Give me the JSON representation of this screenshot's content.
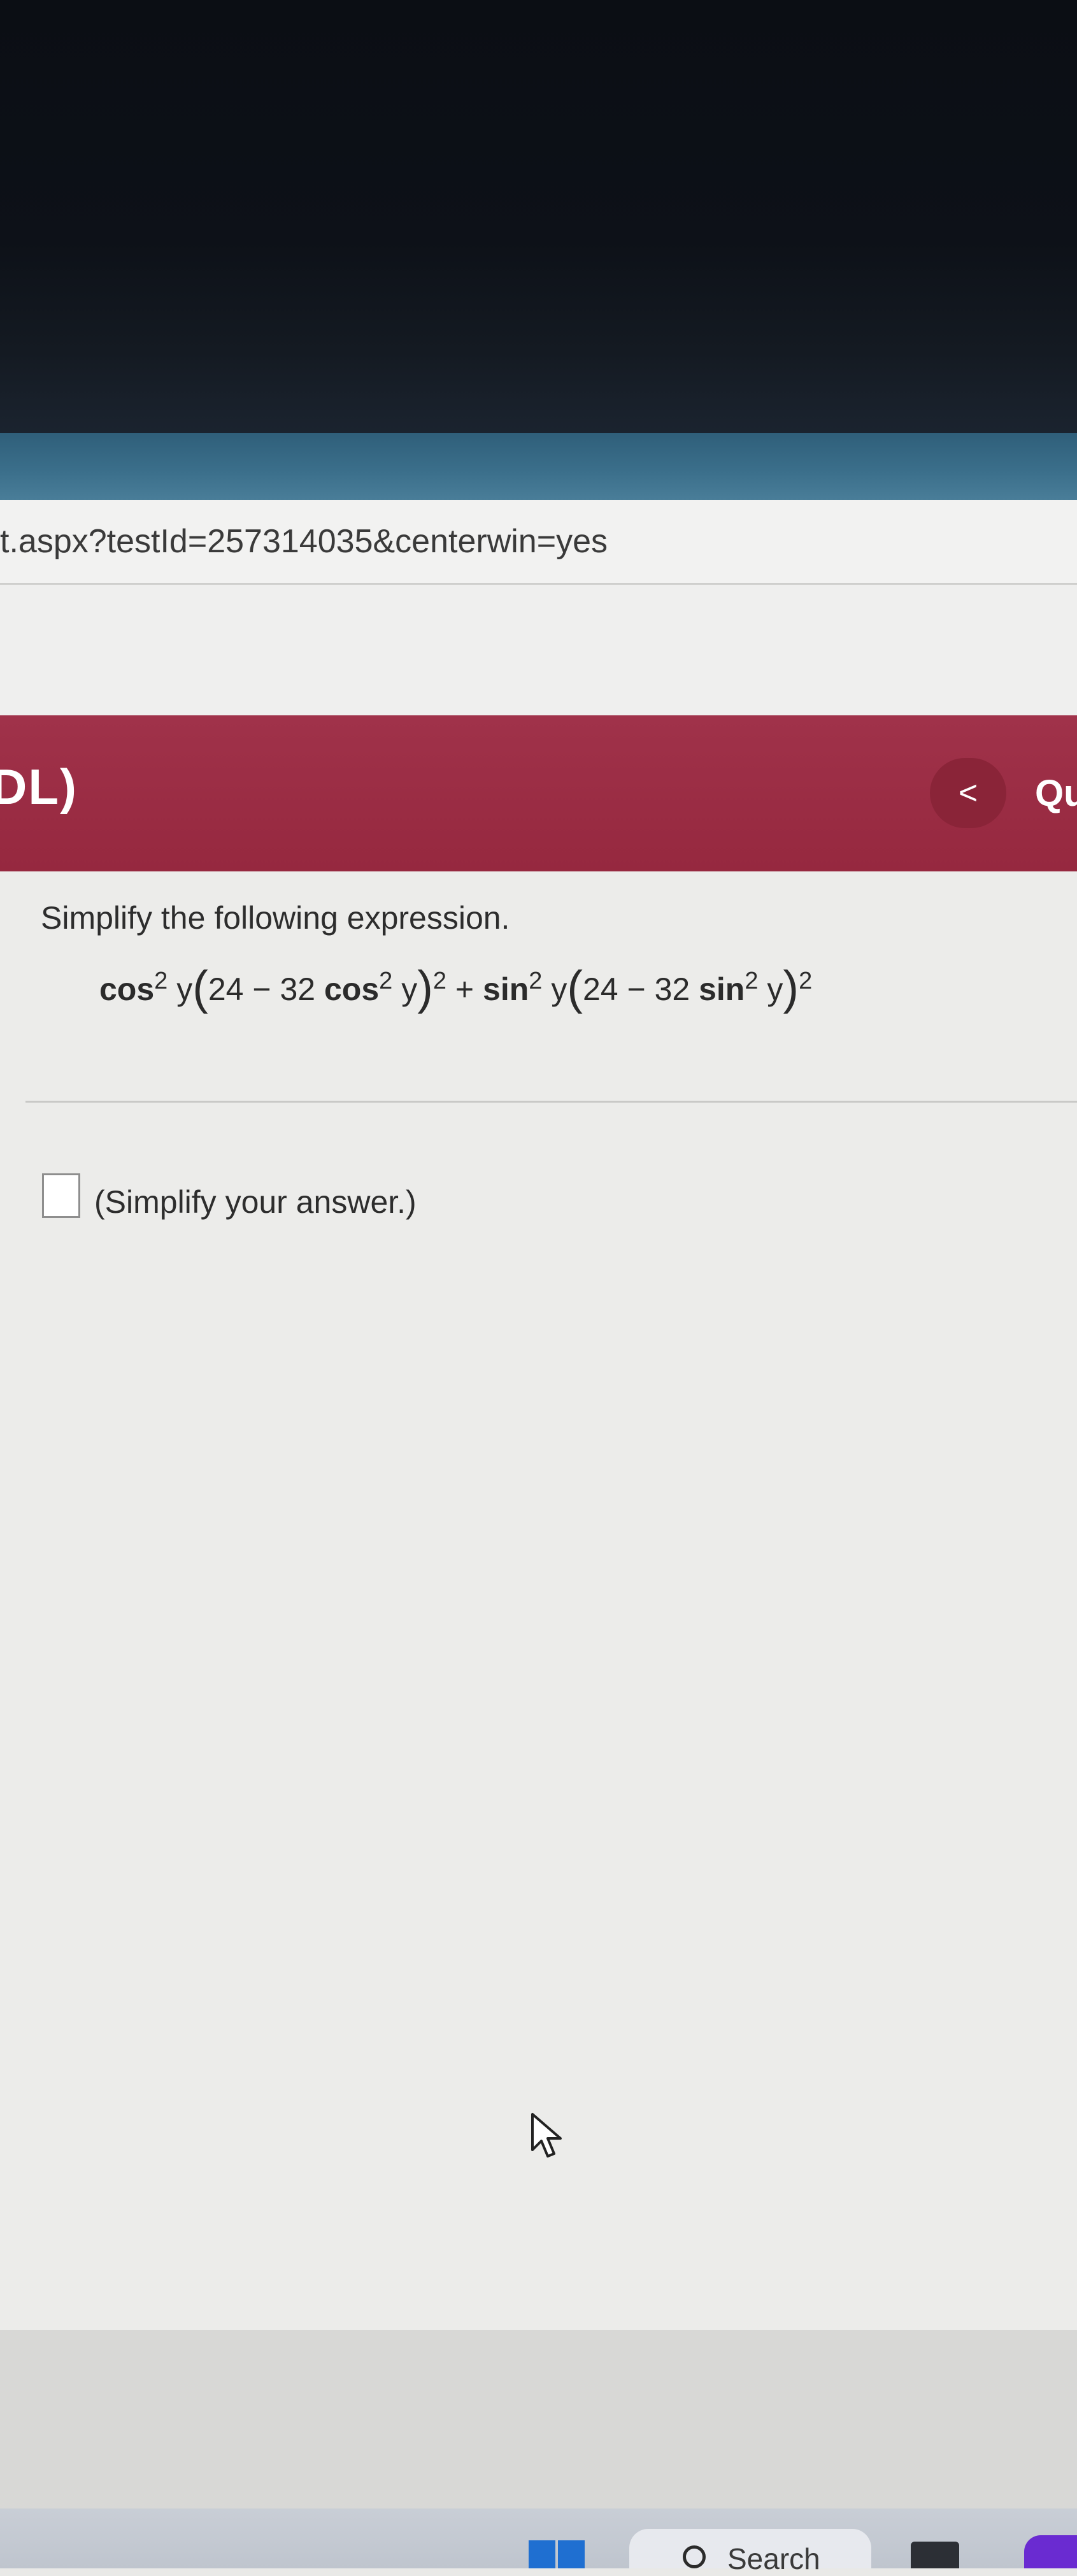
{
  "browser": {
    "url": "t.aspx?testId=257314035&centerwin=yes"
  },
  "header": {
    "title": "DL)",
    "prev_symbol": "<",
    "right_label": "Qu",
    "color": "#9b2d44"
  },
  "question": {
    "instruction": "Simplify the following expression.",
    "expression": {
      "t1_fn": "cos",
      "t1_exp": "2",
      "t1_var": "y",
      "t1_inner_const": "24 − 32",
      "t1_inner_fn": "cos",
      "t1_inner_exp": "2",
      "t1_inner_var": "y",
      "t1_outer_exp": "2",
      "plus": "+",
      "t2_fn": "sin",
      "t2_exp": "2",
      "t2_var": "y",
      "t2_inner_const": "24 − 32",
      "t2_inner_fn": "sin",
      "t2_inner_exp": "2",
      "t2_inner_var": "y",
      "t2_outer_exp": "2"
    }
  },
  "answer": {
    "hint": "(Simplify your answer.)"
  },
  "taskbar": {
    "search_label": "Search",
    "start_icon": "windows-start-icon",
    "search_icon": "search-icon"
  },
  "colors": {
    "header": "#9b2d44",
    "content_bg": "#ececea",
    "taskbar_accent": "#1f6fd1"
  }
}
